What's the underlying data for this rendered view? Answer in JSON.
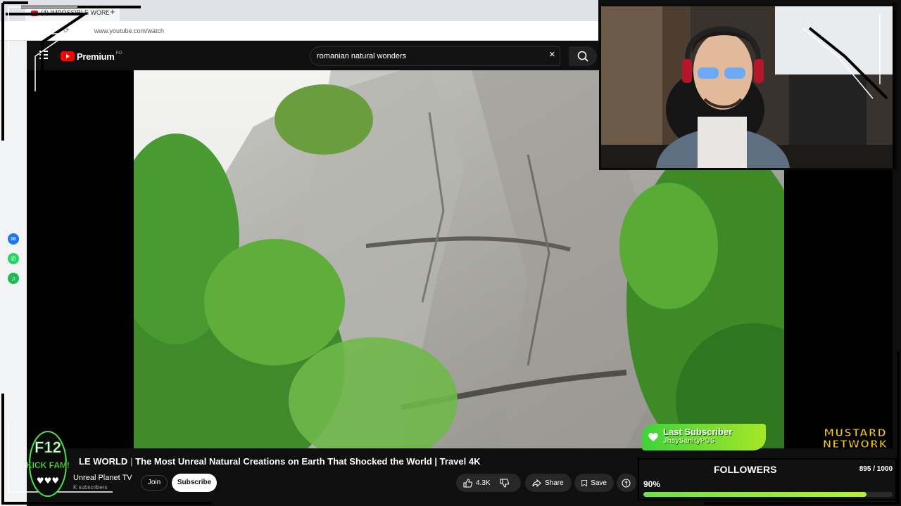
{
  "browser": {
    "tab_title": "(4) IMPOSSIBLE WORL",
    "tab_close": "×",
    "new_tab": "+",
    "url": "www.youtube.com/watch"
  },
  "youtube": {
    "logo_text": "Premium",
    "country_code": "RO",
    "search_query": "romanian natural wonders",
    "search_clear": "×"
  },
  "video": {
    "title_prefix": "LE WORLD",
    "title": "The Most Unreal Natural Creations on Earth That Shocked the World | Travel 4K",
    "channel": "Unreal Planet TV",
    "subscribers": "K subscribers",
    "join_label": "Join",
    "subscribe_label": "Subscribe",
    "likes": "4.3K",
    "share_label": "Share",
    "save_label": "Save"
  },
  "overlay": {
    "badge_line1": "F12",
    "badge_line2": "KICK FAM!",
    "last_subscriber_heading": "Last Subscriber",
    "last_subscriber_name": "JhaySanityPUS",
    "network_line1": "MUSTARD",
    "network_line2": "NETWORK",
    "followers_label": "FOLLOWERS",
    "followers_count": "895 / 1000",
    "followers_percent": "90%",
    "followers_fraction": 0.895
  },
  "colors": {
    "yt_red": "#ff0000",
    "progress_green": "#7be043",
    "mustard": "#f6c913"
  }
}
